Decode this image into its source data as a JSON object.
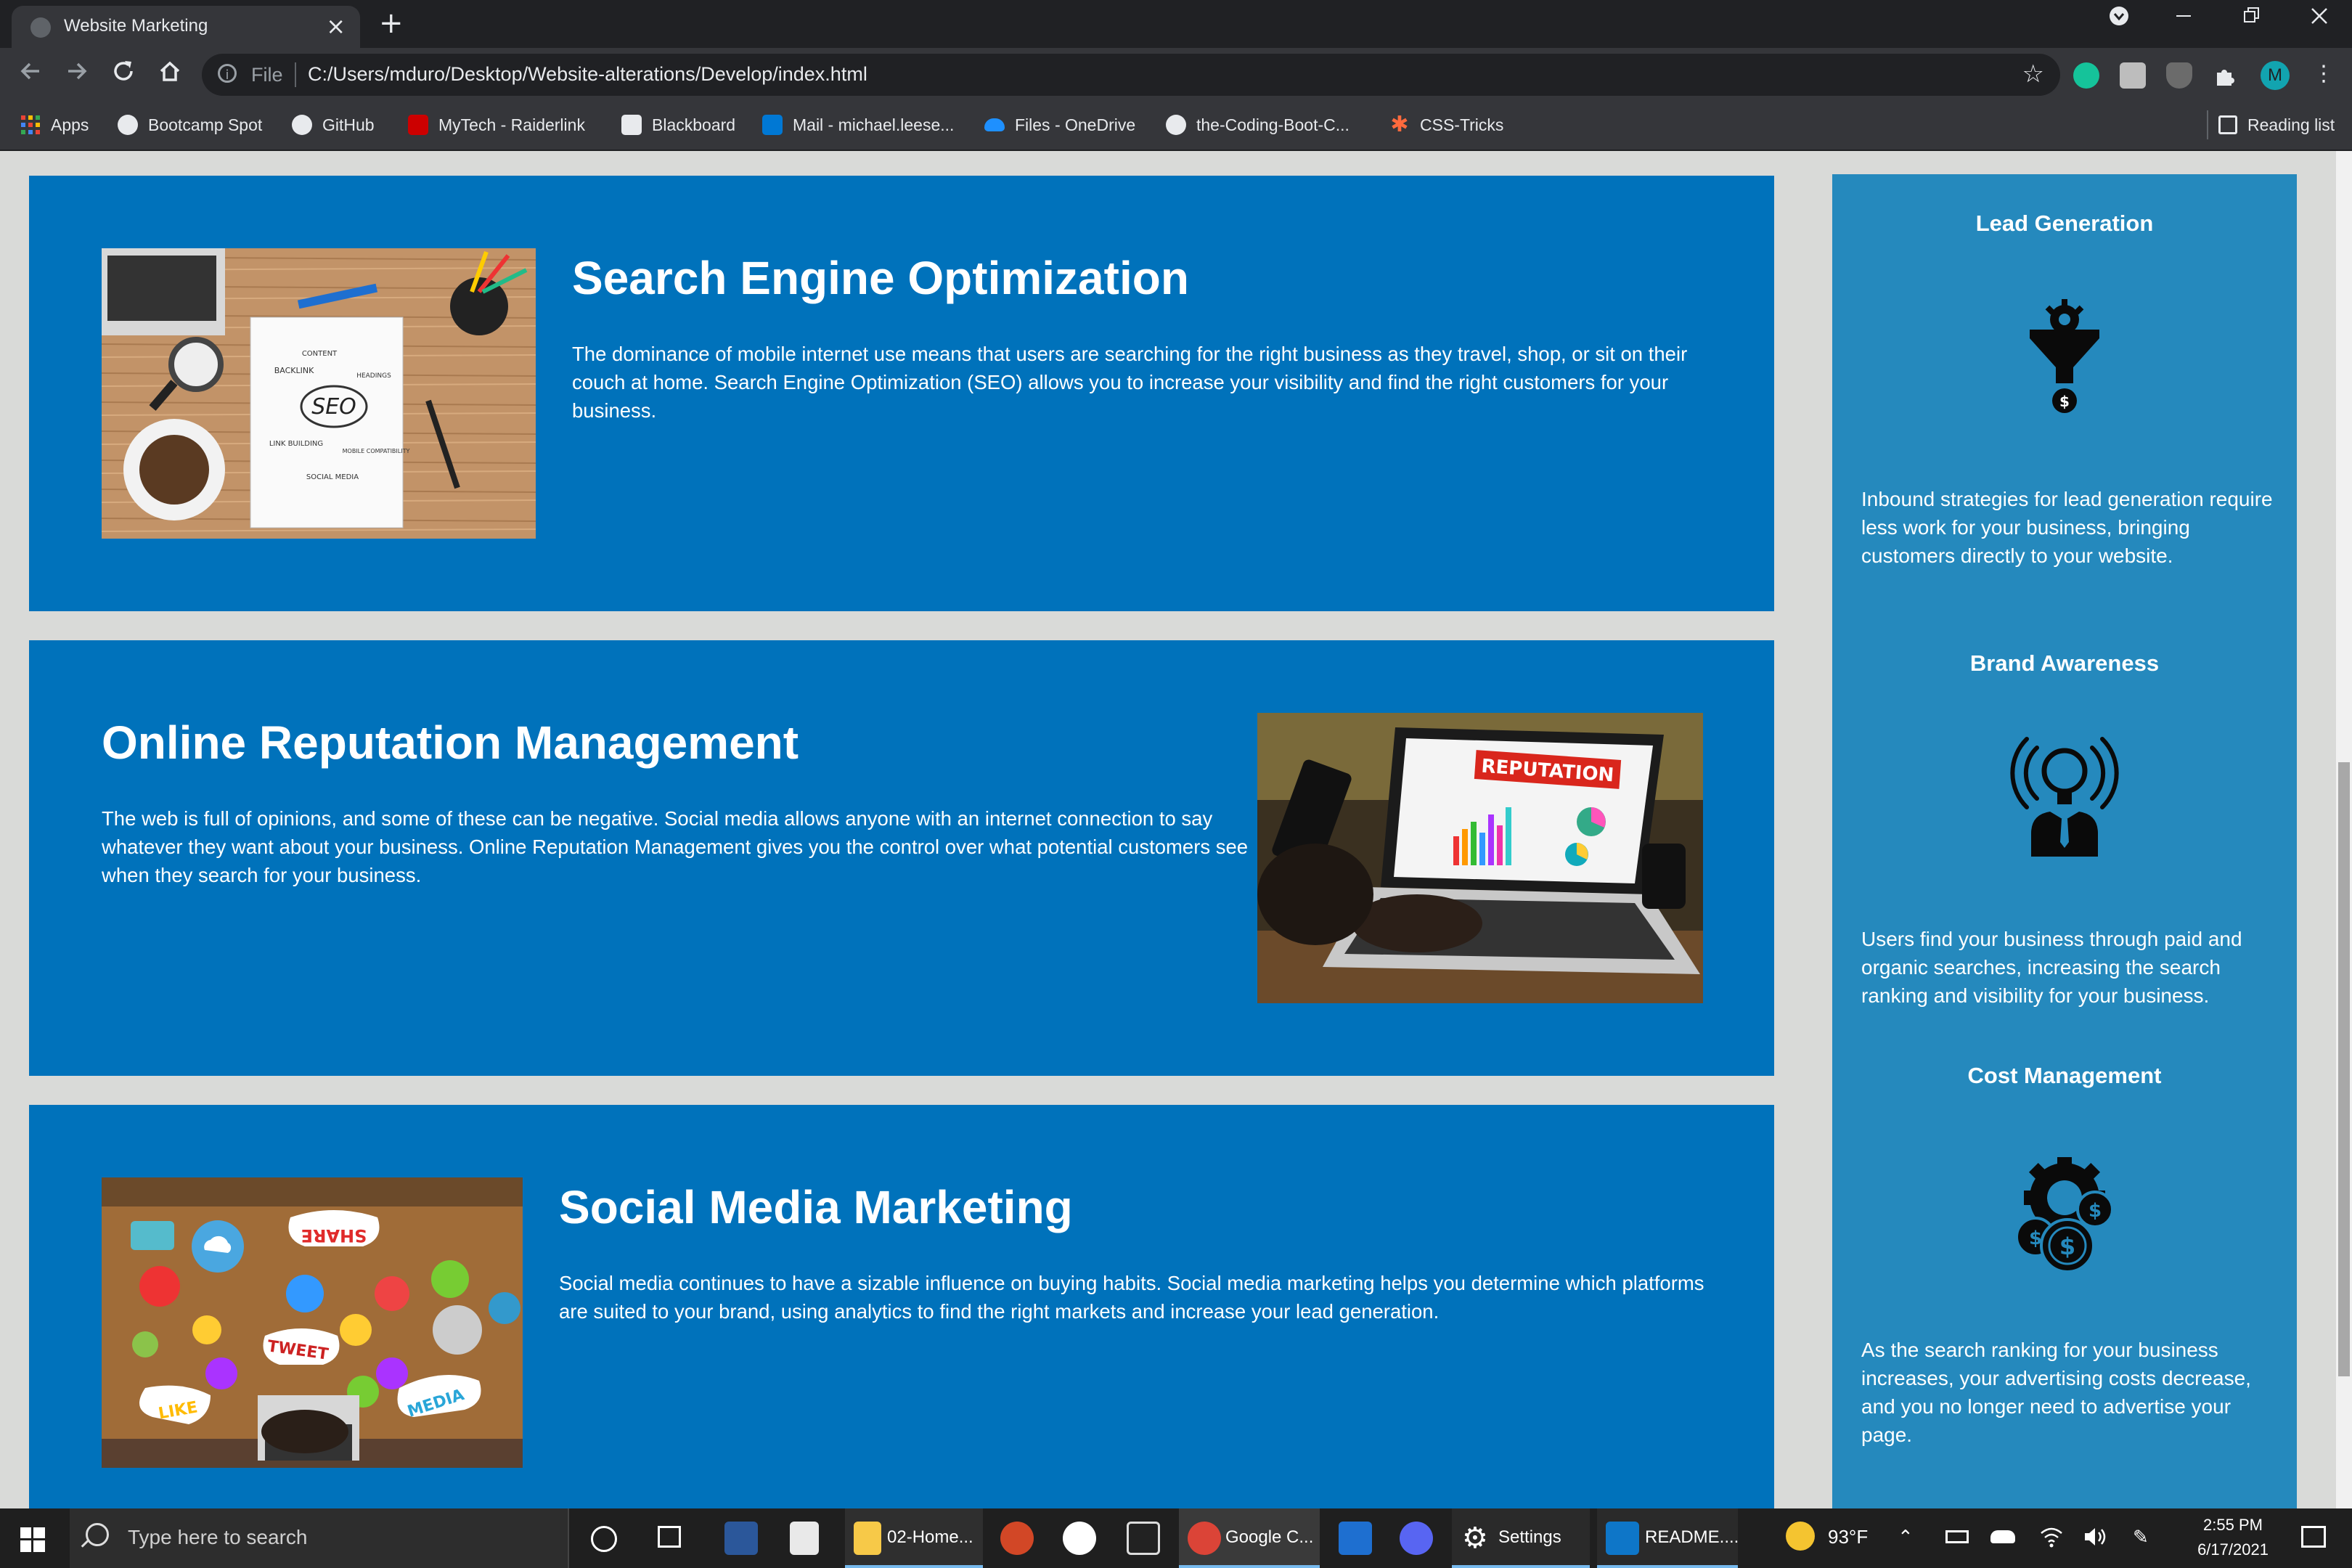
{
  "browser": {
    "tab_title": "Website Marketing",
    "new_tab_symbol": "+",
    "tab_close_symbol": "×",
    "address_scheme": "File",
    "address_url": "C:/Users/mduro/Desktop/Website-alterations/Develop/index.html",
    "profile_initial": "M",
    "bookmarks": [
      {
        "label": "Apps",
        "icon": "apps-grid-icon",
        "color": "#4285f4"
      },
      {
        "label": "Bootcamp Spot",
        "icon": "globe-icon",
        "color": "#e8eaed"
      },
      {
        "label": "GitHub",
        "icon": "github-icon",
        "color": "#e8eaed"
      },
      {
        "label": "MyTech - Raiderlink",
        "icon": "texas-tech-icon",
        "color": "#cc0000"
      },
      {
        "label": "Blackboard",
        "icon": "blackboard-icon",
        "color": "#e8eaed"
      },
      {
        "label": "Mail - michael.leese...",
        "icon": "outlook-icon",
        "color": "#0078d4"
      },
      {
        "label": "Files - OneDrive",
        "icon": "onedrive-icon",
        "color": "#1e90ff"
      },
      {
        "label": "the-Coding-Boot-C...",
        "icon": "github-icon",
        "color": "#e8eaed"
      },
      {
        "label": "CSS-Tricks",
        "icon": "css-tricks-icon",
        "color": "#ff6a3d"
      }
    ],
    "reading_list_label": "Reading list"
  },
  "content": {
    "services": [
      {
        "title": "Search Engine Optimization",
        "body": "The dominance of mobile internet use means that users are searching for the right business as they travel, shop, or sit on their couch at home. Search Engine Optimization (SEO) allows you to increase your visibility and find the right customers for your business.",
        "image_words": [
          "CONTENT",
          "BACKLINK",
          "HEADINGS",
          "SEO",
          "LINK BUILDING",
          "MOBILE COMPATIBILITY",
          "SOCIAL MEDIA"
        ]
      },
      {
        "title": "Online Reputation Management",
        "body": "The web is full of opinions, and some of these can be negative. Social media allows anyone with an internet connection to say whatever they want about your business. Online Reputation Management gives you the control over what potential customers see when they search for your business.",
        "image_words": [
          "REPUTATION"
        ]
      },
      {
        "title": "Social Media Marketing",
        "body": "Social media continues to have a sizable influence on buying habits. Social media marketing helps you determine which platforms are suited to your brand, using analytics to find the right markets and increase your lead generation.",
        "image_words": [
          "SHARE",
          "TWEET",
          "LIKE",
          "MEDIA"
        ]
      }
    ],
    "benefits": [
      {
        "title": "Lead Generation",
        "icon": "lead-funnel-icon",
        "body": "Inbound strategies for lead generation require less work for your business, bringing customers directly to your website."
      },
      {
        "title": "Brand Awareness",
        "icon": "lightbulb-broadcast-icon",
        "body": "Users find your business through paid and organic searches, increasing the search ranking and visibility for your business."
      },
      {
        "title": "Cost Management",
        "icon": "gear-dollar-icon",
        "body": "As the search ranking for your business increases, your advertising costs decrease, and you no longer need to advertise your page."
      }
    ]
  },
  "taskbar": {
    "search_placeholder": "Type here to search",
    "apps": [
      {
        "label": "02-Home...",
        "icon": "file-explorer-icon"
      },
      {
        "label": "Google C...",
        "icon": "chrome-icon"
      },
      {
        "label": "Settings",
        "icon": "settings-icon"
      },
      {
        "label": "README....",
        "icon": "vscode-icon"
      }
    ],
    "weather": "93°F",
    "time": "2:55 PM",
    "date": "6/17/2021"
  },
  "colors": {
    "card_blue": "#0072bb",
    "aside_blue": "#2589bd",
    "page_bg": "#d9dad8"
  }
}
